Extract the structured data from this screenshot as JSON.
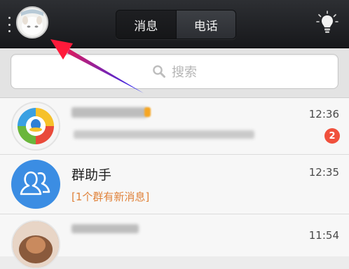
{
  "topbar": {
    "tabs": [
      {
        "label": "消息",
        "active": true
      },
      {
        "label": "电话",
        "active": false
      }
    ]
  },
  "search": {
    "placeholder": "搜索"
  },
  "chats": [
    {
      "name": "",
      "time": "12:36",
      "preview": "",
      "badge": "2",
      "avatar": "qzone-icon"
    },
    {
      "name": "群助手",
      "time": "12:35",
      "preview": "[1个群有新消息]",
      "badge": "",
      "avatar": "group-icon"
    },
    {
      "name": "",
      "time": "11:54",
      "preview": "",
      "badge": "",
      "avatar": "photo-avatar"
    }
  ],
  "colors": {
    "accent": "#f0503c",
    "group_blue": "#3b8de3",
    "preview_orange": "#e0823a",
    "arrow": "#2d35e8"
  }
}
